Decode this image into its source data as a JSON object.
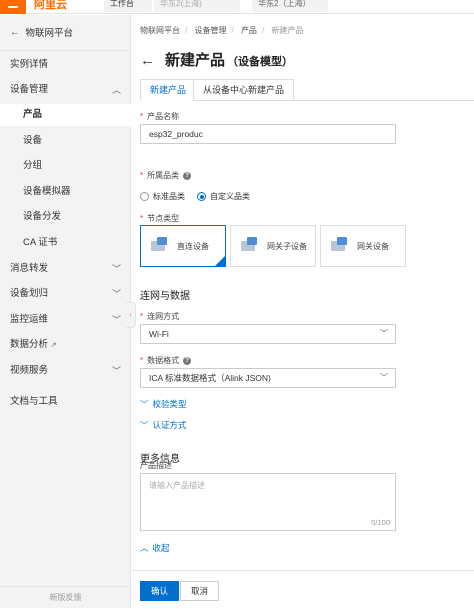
{
  "top": {
    "logo": "阿里云",
    "pill_one": "工作台",
    "pill_two": "华东2(上海)",
    "pill_three": "华东2（上海）"
  },
  "sidebar": {
    "back_label": "物联网平台",
    "items": [
      {
        "label": "实例详情",
        "level": "top",
        "expandable": false
      },
      {
        "label": "设备管理",
        "level": "top",
        "expandable": true,
        "expanded": true
      },
      {
        "label": "产品",
        "level": "sub",
        "active": true
      },
      {
        "label": "设备",
        "level": "sub"
      },
      {
        "label": "分组",
        "level": "sub"
      },
      {
        "label": "设备模拟器",
        "level": "sub"
      },
      {
        "label": "设备分发",
        "level": "sub"
      },
      {
        "label": "CA 证书",
        "level": "sub"
      },
      {
        "label": "消息转发",
        "level": "top",
        "expandable": true
      },
      {
        "label": "设备划归",
        "level": "top",
        "expandable": true
      },
      {
        "label": "监控运维",
        "level": "top",
        "expandable": true
      },
      {
        "label": "数据分析",
        "level": "top",
        "external": true
      },
      {
        "label": "视频服务",
        "level": "top",
        "expandable": true
      },
      {
        "label": "文档与工具",
        "level": "top"
      }
    ],
    "footer": "新版反馈"
  },
  "breadcrumb": [
    "物联网平台",
    "设备管理",
    "产品",
    "新建产品"
  ],
  "title": {
    "main": "新建产品",
    "sub": "（设备模型）"
  },
  "tabs": [
    {
      "label": "新建产品",
      "active": true
    },
    {
      "label": "从设备中心新建产品",
      "active": false
    }
  ],
  "form": {
    "product_name_label": "产品名称",
    "product_name_value": "esp32_produc",
    "category_label": "所属品类",
    "category_options": [
      {
        "label": "标准品类",
        "checked": false
      },
      {
        "label": "自定义品类",
        "checked": true
      }
    ],
    "node_type_label": "节点类型",
    "node_types": [
      {
        "label": "直连设备",
        "selected": true
      },
      {
        "label": "网关子设备",
        "selected": false
      },
      {
        "label": "网关设备",
        "selected": false
      }
    ],
    "section_network": "连网与数据",
    "network_label": "连网方式",
    "network_value": "Wi-Fi",
    "data_format_label": "数据格式",
    "data_format_value": "ICA 标准数据格式（Alink JSON)",
    "verify_type_link": "校验类型",
    "auth_method_link": "认证方式",
    "section_more": "更多信息",
    "description_label": "产品描述",
    "description_placeholder": "请输入产品描述",
    "description_counter": "0/100",
    "collapse_link": "收起"
  },
  "footer": {
    "confirm": "确认",
    "cancel": "取消"
  },
  "colors": {
    "accent": "#0070cc",
    "brand": "#ff6a00"
  }
}
